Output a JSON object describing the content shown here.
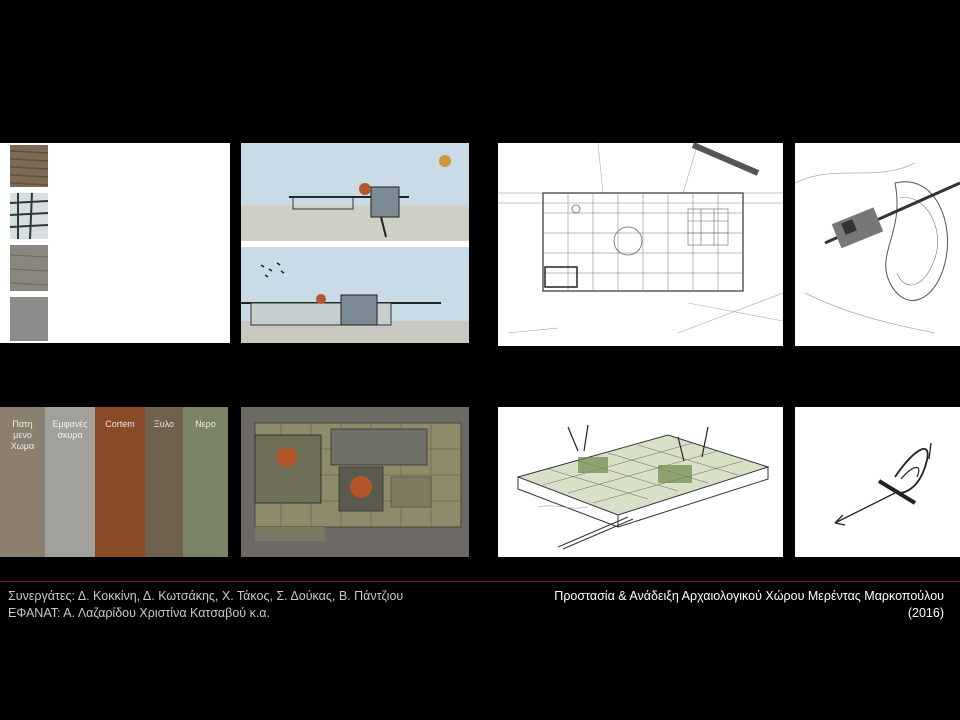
{
  "footer": {
    "credits_line1": "Συνεργάτες: Δ. Κοκκίνη, Δ. Κωτσάκης, Χ. Τάκος, Σ. Δούκας, Β. Πάντζιου",
    "credits_line2": "ΕΦΑΝΑΤ:  Α. Λαζαρίδου Χριστίνα Κατσαβού κ.α.",
    "project_title": "Προστασία & Ανάδειξη Αρχαιολογικού Χώρου Μερέντας Μαρκοπούλου",
    "project_year": "(2016)"
  },
  "materials": [
    {
      "label": "Πατη\nμενο\nΧωμα",
      "color": "#8b7f70"
    },
    {
      "label": "Εμφανές\nσκυρο",
      "color": "#9c9a95"
    },
    {
      "label": "Cortem",
      "color": "#8a4a2a"
    },
    {
      "label": "Ξυλο",
      "color": "#6a5e4c"
    },
    {
      "label": "Νερο",
      "color": "#77806a"
    }
  ],
  "colors": {
    "background": "#000000",
    "divider": "#7a1f1f",
    "sky": "#c9dbe6",
    "corten": "#b5562a"
  }
}
